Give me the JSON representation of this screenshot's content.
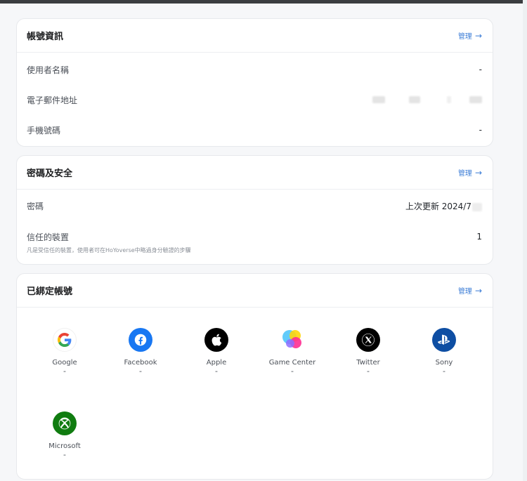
{
  "account_info": {
    "title": "帳號資訊",
    "manage_label": "管理",
    "rows": [
      {
        "label": "使用者名稱",
        "value": "-"
      },
      {
        "label": "電子郵件地址",
        "value": ""
      },
      {
        "label": "手機號碼",
        "value": "-"
      }
    ]
  },
  "security": {
    "title": "密碼及安全",
    "manage_label": "管理",
    "password_label": "密碼",
    "password_value": "上次更新 2024/7",
    "trusted_label": "信任的裝置",
    "trusted_value": "1",
    "trusted_note": "凡是受信任的裝置，使用者可在HoYoverse中略過身分驗證的步驟"
  },
  "linked": {
    "title": "已綁定帳號",
    "manage_label": "管理",
    "accounts": [
      {
        "name": "Google",
        "value": "-",
        "icon": "google-icon"
      },
      {
        "name": "Facebook",
        "value": "-",
        "icon": "facebook-icon"
      },
      {
        "name": "Apple",
        "value": "-",
        "icon": "apple-icon"
      },
      {
        "name": "Game Center",
        "value": "-",
        "icon": "game-center-icon"
      },
      {
        "name": "Twitter",
        "value": "-",
        "icon": "x-icon"
      },
      {
        "name": "Sony",
        "value": "-",
        "icon": "playstation-icon"
      },
      {
        "name": "Microsoft",
        "value": "-",
        "icon": "xbox-icon"
      }
    ]
  },
  "colors": {
    "accent": "#3b7cd6",
    "facebook": "#1877f2",
    "playstation": "#0e4ea3",
    "xbox": "#107c10"
  }
}
